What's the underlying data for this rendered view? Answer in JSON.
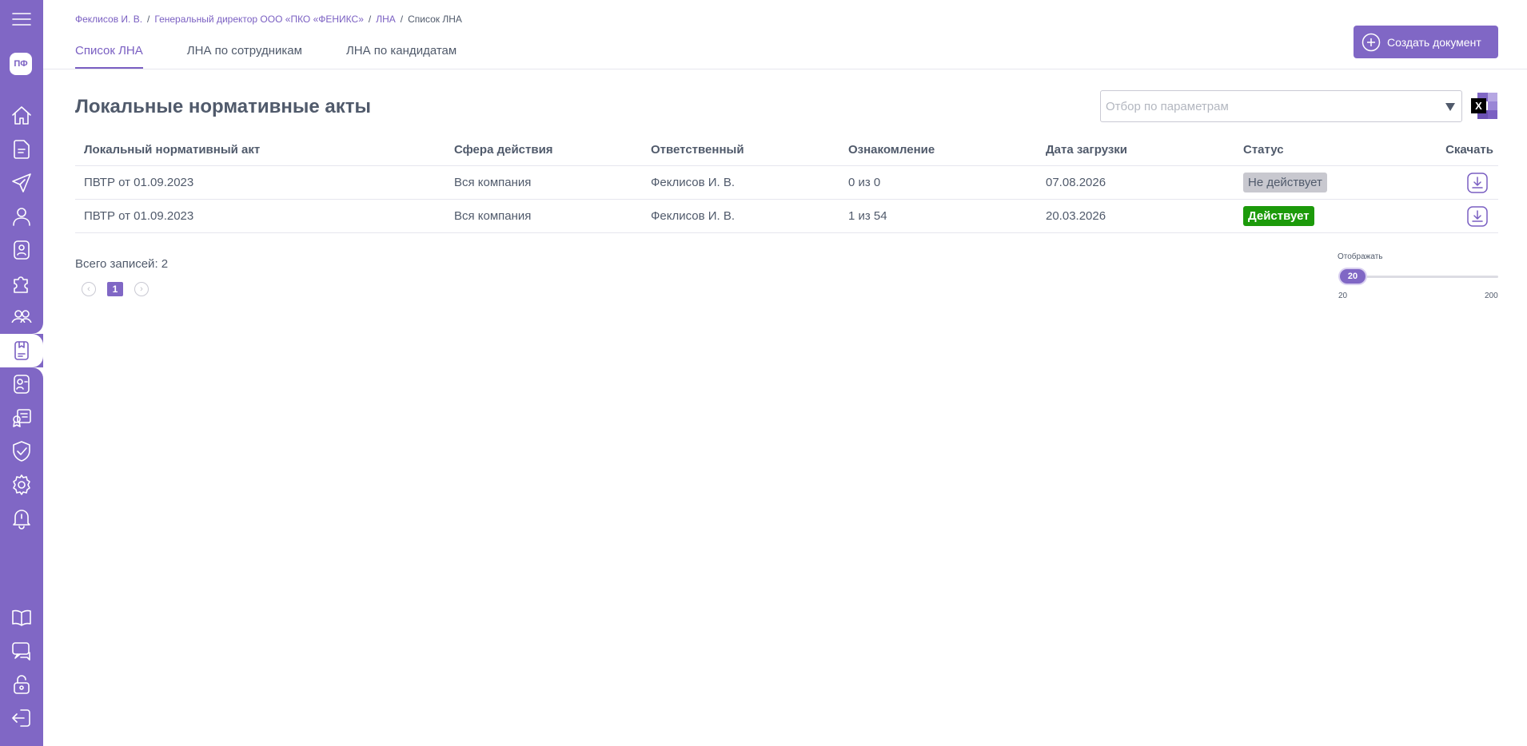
{
  "sidebar": {
    "avatar_initials": "ПФ",
    "icons": [
      "menu-icon",
      "home-icon",
      "document-icon",
      "send-icon",
      "user-icon",
      "badge-icon",
      "puzzle-icon",
      "team-icon",
      "lna-icon",
      "user-card-icon",
      "certificate-icon",
      "shield-icon",
      "gear-icon",
      "bell-icon",
      "book-icon",
      "support-icon",
      "lock-icon",
      "logout-icon"
    ]
  },
  "breadcrumb": {
    "items": [
      "Феклисов И. В.",
      "Генеральный директор ООО «ПКО «ФЕНИКС»",
      "ЛНА"
    ],
    "separator": "/",
    "current": "Список ЛНА"
  },
  "tabs": [
    {
      "label": "Список ЛНА",
      "active": true
    },
    {
      "label": "ЛНА по сотрудникам",
      "active": false
    },
    {
      "label": "ЛНА по кандидатам",
      "active": false
    }
  ],
  "toolbar": {
    "create_label": "Создать документ"
  },
  "page": {
    "title": "Локальные нормативные акты"
  },
  "filter": {
    "placeholder": "Отбор по параметрам"
  },
  "export": {
    "excel_letter": "X"
  },
  "table": {
    "headers": [
      "Локальный нормативный акт",
      "Сфера действия",
      "Ответственный",
      "Ознакомление",
      "Дата загрузки",
      "Статус",
      "Скачать"
    ],
    "rows": [
      {
        "act": "ПВТР от 01.09.2023",
        "scope": "Вся компания",
        "responsible": "Феклисов И. В.",
        "acquaintance": "0 из 0",
        "date": "07.08.2026",
        "status": "Не действует"
      },
      {
        "act": "ПВТР от 01.09.2023",
        "scope": "Вся компания",
        "responsible": "Феклисов И. В.",
        "acquaintance": "1 из 54",
        "date": "20.03.2026",
        "status": "Действует"
      }
    ]
  },
  "footer": {
    "total": "Всего записей: 2",
    "current_page": "1",
    "per_page_label": "Отображать",
    "per_page_value": "20",
    "per_page_min": "20",
    "per_page_max": "200"
  },
  "colors": {
    "accent": "#8067c5",
    "status_active": "#1c9a0a",
    "status_inactive": "#c8c8cf"
  }
}
